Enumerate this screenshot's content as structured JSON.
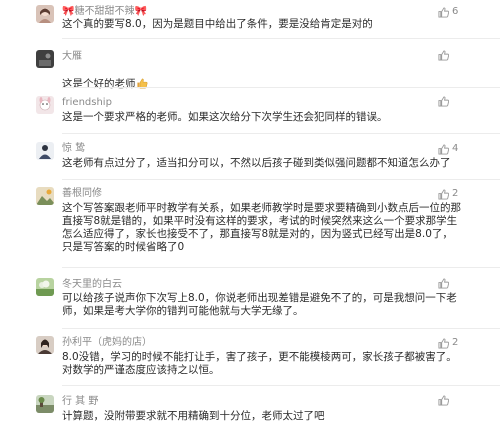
{
  "comments": [
    {
      "username": "🎀糖不甜甜不辣🎀",
      "text": "这个真的要写8.0，因为是题目中给出了条件，要是没给肯定是对的",
      "likes": "6",
      "avatar_icon": "avatar-girl-icon",
      "avatar_color": "#c9a89a"
    },
    {
      "username": "大雁",
      "text": "这是个好的老师",
      "emoji": "thumbs-up-emoji",
      "likes": "",
      "avatar_icon": "avatar-dark-icon",
      "avatar_color": "#4a4a4a"
    },
    {
      "username": "friendship",
      "text": "这是一个要求严格的老师。如果这次给分下次学生还会犯同样的错误。",
      "likes": "",
      "avatar_icon": "avatar-cartoon-icon",
      "avatar_color": "#e7d3d6"
    },
    {
      "username": "惊 鸷",
      "text": "这老师有点过分了，适当扣分可以，不然以后孩子碰到类似强问题都不知道怎么办了",
      "likes": "4",
      "avatar_icon": "avatar-person-icon",
      "avatar_color": "#7b7f8a"
    },
    {
      "username": "善根同修",
      "text": "这个写答案跟老师平时教学有关系，如果老师教学时是要求要精确到小数点后一位的那直接写8就是错的，如果平时没有这样的要求，考试的时候突然来这么一个要求那学生怎么适应得了，家长也接受不了，那直接写8就是对的，因为竖式已经写出是8.0了，只是写答案的时候省略了0",
      "likes": "2",
      "avatar_icon": "avatar-landscape-icon",
      "avatar_color": "#c8b48a"
    },
    {
      "username": "冬天里的白云",
      "text": "可以给孩子说声你下次写上8.0，你说老师出现差错是避免不了的，可是我想问一下老师，如果是考大学你的错判可能他就与大学无缘了。",
      "likes": "",
      "avatar_icon": "avatar-nature-icon",
      "avatar_color": "#8fb07a"
    },
    {
      "username": "孙利平（虎妈的店）",
      "text": "8.0没错，学习的时候不能打让手，害了孩子，更不能模棱两可，家长孩子都被害了。对数学的严谨态度应该持之以恒。",
      "likes": "2",
      "avatar_icon": "avatar-woman-icon",
      "avatar_color": "#9a8576"
    },
    {
      "username": "行 其 野",
      "text": "计算题，没附带要求就不用精确到十分位，老师太过了吧",
      "likes": "",
      "avatar_icon": "avatar-scene-icon",
      "avatar_color": "#8a9a7a"
    }
  ],
  "colors": {
    "username": "#8a8a8a",
    "text": "#2b2b2b",
    "divider": "#ececec",
    "like_icon": "#9a9a9a"
  }
}
